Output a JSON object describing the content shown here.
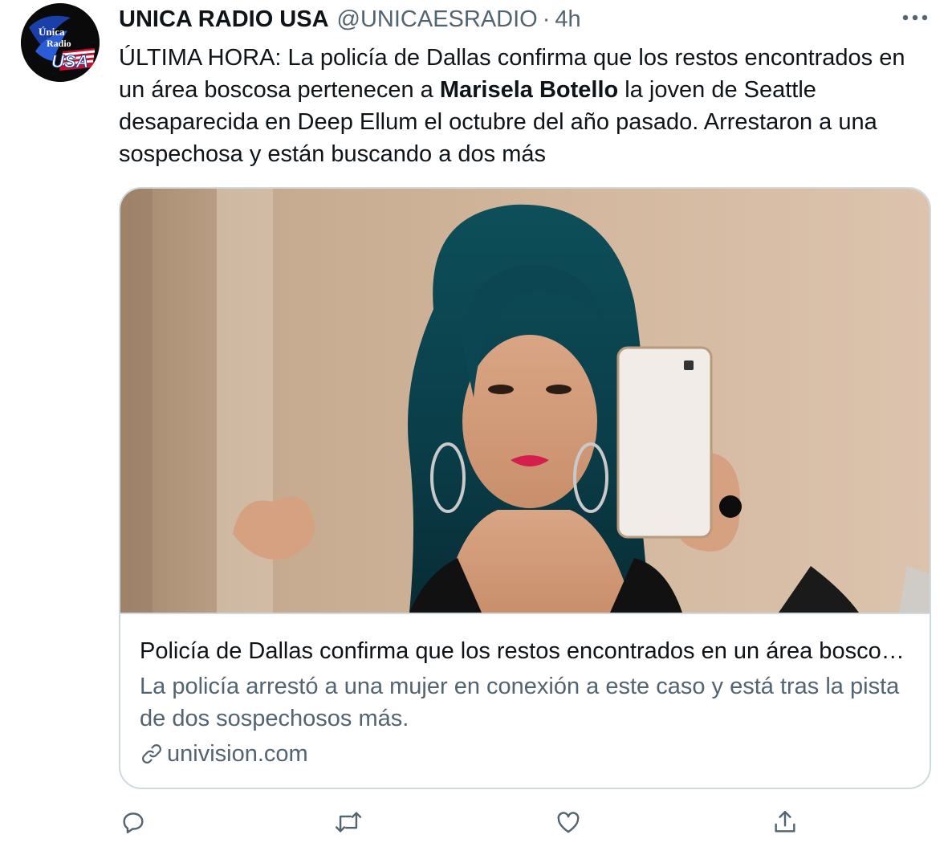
{
  "tweet": {
    "display_name": "UNICA RADIO USA",
    "handle": "@UNICAESRADIO",
    "separator": "·",
    "time": "4h",
    "avatar": {
      "line1": "Única",
      "line2": "Radio",
      "line3": "USA"
    },
    "text_before": "ÚLTIMA HORA: La policía de Dallas confirma que los restos encontrados en un área boscosa pertenecen a ",
    "text_bold": "Marisela Botello",
    "text_after": " la joven de Seattle desaparecida en Deep Ellum el octubre del año pasado. Arrestaron a una sospechosa y están buscando a dos más"
  },
  "card": {
    "title": "Policía de Dallas confirma que los restos encontrados en un área boscosa pertenecen a Marisela Botello",
    "description": "La policía arrestó a una mujer en conexión a este caso y está tras la pista de dos sospechosos más.",
    "domain": "univision.com"
  },
  "icons": {
    "more": "more-horizontal-icon",
    "link": "link-icon",
    "reply": "reply-icon",
    "retweet": "retweet-icon",
    "like": "like-icon",
    "share": "share-icon"
  },
  "colors": {
    "primary_text": "#0f1419",
    "secondary_text": "#536471",
    "border": "#cfd9de"
  }
}
